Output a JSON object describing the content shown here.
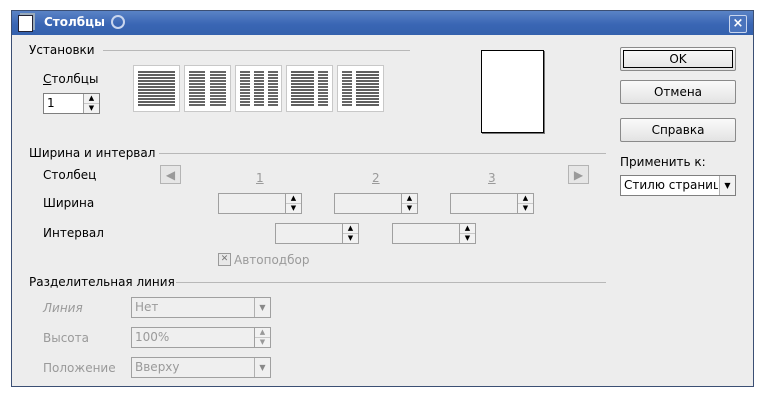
{
  "window": {
    "title": "Столбцы",
    "close_icon": "×"
  },
  "settings": {
    "section_label": "Установки",
    "columns_label": "Столбцы",
    "columns_value": "1",
    "presets": [
      {
        "name": "preset-1-column"
      },
      {
        "name": "preset-2-columns"
      },
      {
        "name": "preset-3-columns"
      },
      {
        "name": "preset-2-columns-wide-left"
      },
      {
        "name": "preset-2-columns-wide-right"
      }
    ]
  },
  "width_spacing": {
    "section_label": "Ширина и интервал",
    "column_label": "Столбец",
    "width_label": "Ширина",
    "spacing_label": "Интервал",
    "column_numbers": [
      "1",
      "2",
      "3"
    ],
    "autofit_label": "Автоподбор",
    "prev_icon": "arrow-left-icon",
    "next_icon": "arrow-right-icon"
  },
  "separator": {
    "section_label": "Разделительная линия",
    "line_label": "Линия",
    "line_value": "Нет",
    "height_label": "Высота",
    "height_value": "100%",
    "position_label": "Положение",
    "position_value": "Вверху"
  },
  "buttons": {
    "ok": "OK",
    "cancel": "Отмена",
    "help": "Справка"
  },
  "apply": {
    "label": "Применить к:",
    "value": "Стилю страниц"
  }
}
